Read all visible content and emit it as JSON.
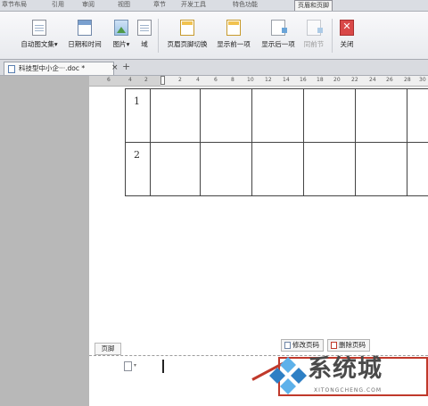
{
  "menubar": {
    "tabs": [
      {
        "label": "章节布局",
        "active": false
      },
      {
        "label": "引用",
        "active": false
      },
      {
        "label": "审阅",
        "active": false
      },
      {
        "label": "视图",
        "active": false
      },
      {
        "label": "章节",
        "active": false
      },
      {
        "label": "开发工具",
        "active": false
      },
      {
        "label": "特色功能",
        "active": false
      },
      {
        "label": "页眉和页脚",
        "active": true
      }
    ]
  },
  "ribbon": {
    "buttons": [
      {
        "label": "自动图文集",
        "dropdown": "▾"
      },
      {
        "label": "日期和时间"
      },
      {
        "label": "图片",
        "dropdown": "▾"
      },
      {
        "label": "域"
      },
      {
        "label": "页眉页脚切换"
      },
      {
        "label": "显示前一项"
      },
      {
        "label": "显示后一项"
      },
      {
        "label": "同前节",
        "disabled": true
      },
      {
        "label": "关闭"
      }
    ]
  },
  "doc_tabs": {
    "active_name": "科技型中小企···.doc",
    "modified_marker": "*",
    "close_glyph": "×",
    "new_tab_glyph": "+"
  },
  "ruler": {
    "labels": [
      "6",
      "4",
      "2",
      "2",
      "4",
      "6",
      "8",
      "10",
      "12",
      "14",
      "16",
      "18",
      "20",
      "22",
      "24",
      "26",
      "28",
      "30"
    ]
  },
  "table": {
    "row_numbers": [
      "1",
      "2"
    ]
  },
  "footer": {
    "label": "页脚",
    "edit_page_number": "修改页码",
    "delete_page_number": "删除页码",
    "dropdown_arrow": "▾"
  },
  "watermark": {
    "title": "系统城",
    "subtitle": "XITONGCHENG.COM",
    "partial_text": "第"
  },
  "colors": {
    "accent_red": "#c0392b",
    "active_tab_border": "#8e8e96",
    "logo_blue": "#2e7fc4",
    "logo_light_blue": "#5db1ea"
  }
}
